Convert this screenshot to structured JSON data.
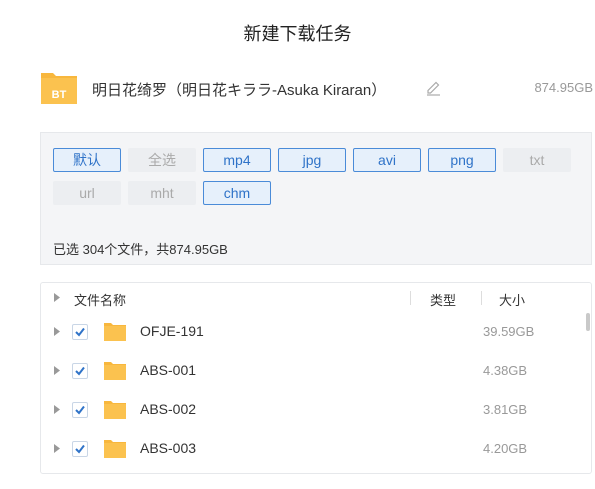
{
  "dialog": {
    "title": "新建下载任务"
  },
  "task": {
    "icon": "bt-folder-icon",
    "badge": "BT",
    "name": "明日花绮罗（明日花キララ-Asuka Kiraran）",
    "total_size": "874.95GB"
  },
  "filters": {
    "tags": [
      {
        "label": "默认",
        "active": true
      },
      {
        "label": "全选",
        "active": false
      },
      {
        "label": "mp4",
        "active": true
      },
      {
        "label": "jpg",
        "active": true
      },
      {
        "label": "avi",
        "active": true
      },
      {
        "label": "png",
        "active": true
      },
      {
        "label": "txt",
        "active": false
      },
      {
        "label": "url",
        "active": false
      },
      {
        "label": "mht",
        "active": false
      },
      {
        "label": "chm",
        "active": true
      }
    ],
    "summary": "已选 304个文件，共874.95GB"
  },
  "file_list": {
    "columns": {
      "name": "文件名称",
      "type": "类型",
      "size": "大小"
    },
    "rows": [
      {
        "name": "OFJE-191",
        "size": "39.59GB",
        "checked": true
      },
      {
        "name": "ABS-001",
        "size": "4.38GB",
        "checked": true
      },
      {
        "name": "ABS-002",
        "size": "3.81GB",
        "checked": true
      },
      {
        "name": "ABS-003",
        "size": "4.20GB",
        "checked": true
      }
    ]
  },
  "colors": {
    "accent": "#2f73c8",
    "folder": "#f8b73d",
    "muted_text": "#999999"
  }
}
